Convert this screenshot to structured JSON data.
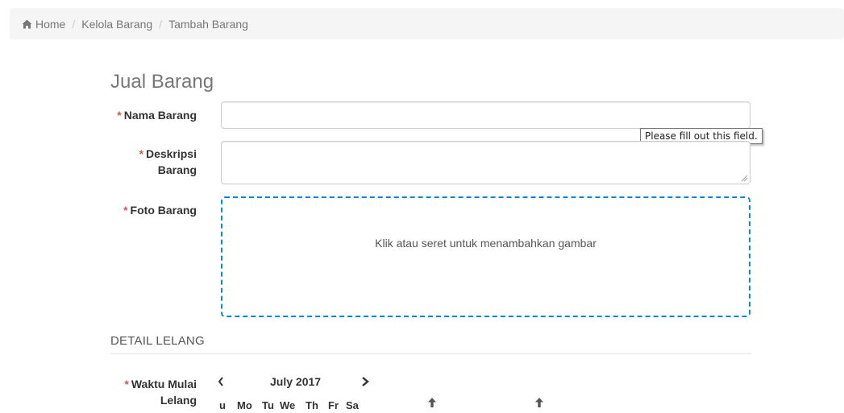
{
  "breadcrumb": {
    "home": "Home",
    "separator": "/",
    "items": [
      "Kelola Barang",
      "Tambah Barang"
    ]
  },
  "page_title": "Jual Barang",
  "form": {
    "required_mark": "*",
    "nama_barang": {
      "label": "Nama Barang",
      "value": ""
    },
    "deskripsi": {
      "label_line1": "Deskripsi",
      "label_line2": "Barang",
      "value": ""
    },
    "foto": {
      "label": "Foto Barang",
      "dropzone_text": "Klik atau seret untuk menambahkan gambar"
    },
    "validation_tooltip": "Please fill out this field."
  },
  "detail_lelang": {
    "section_title": "DETAIL LELANG",
    "waktu_mulai": {
      "label_line1": "Waktu Mulai",
      "label_line2": "Lelang"
    }
  },
  "calendar": {
    "month_label": "July 2017",
    "weekdays": [
      "u",
      "Mo",
      "Tu",
      "We",
      "Th",
      "Fr",
      "Sa"
    ]
  },
  "icons": {
    "home": "home-icon",
    "prev": "chevron-left-icon",
    "next": "chevron-right-icon",
    "up": "arrow-up-icon"
  },
  "colors": {
    "required": "#d9534f",
    "dropzone_border": "#0087f7",
    "breadcrumb_bg": "#f5f5f5"
  }
}
